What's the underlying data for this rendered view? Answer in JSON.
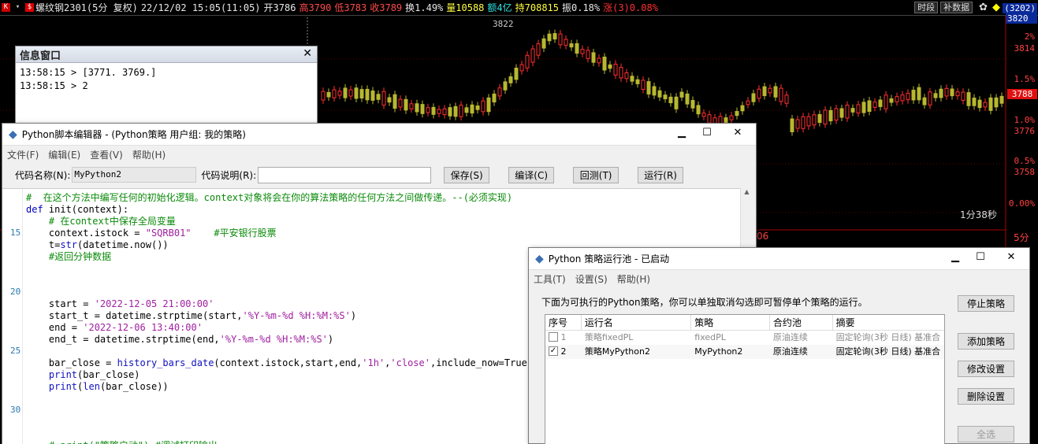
{
  "chart_header": {
    "symbol": "螺纹钢2301(5分 复权)",
    "datetime": "22/12/02 15:05(11:05)",
    "open": "开3786",
    "high": "高3790",
    "low": "低3783",
    "close": "收3789",
    "turnover": "换1.49%",
    "volume": "量10588",
    "amount": "额4亿",
    "hold": "持708815",
    "amplitude": "振0.18%",
    "change": "涨(3)0.08%",
    "btn_time": "时段",
    "btn_fill": "补数据",
    "axis_top_badge": "(3202)",
    "axis_top_value": "3820"
  },
  "chart_axis": {
    "labels": [
      "2%",
      "3814",
      "1.5%",
      "1.0%",
      "3776",
      "0.5%",
      "3758",
      "0.00%"
    ],
    "current_price": "3788",
    "peak_label": "3822",
    "timer": "1分38秒",
    "bottom_period": "5分",
    "bottom_frag": "06"
  },
  "info_window": {
    "title": "信息窗口",
    "lines": [
      "13:58:15 > [3771. 3769.]",
      "13:58:15 > 2"
    ]
  },
  "editor": {
    "title": "Python脚本编辑器 - (Python策略 用户组: 我的策略)",
    "menu": [
      "文件(F)",
      "编辑(E)",
      "查看(V)",
      "帮助(H)"
    ],
    "code_name_label": "代码名称(N):",
    "code_name_value": "MyPython2",
    "code_desc_label": "代码说明(R):",
    "buttons": [
      "保存(S)",
      "编译(C)",
      "回测(T)",
      "运行(R)"
    ],
    "line_numbers": [
      "15",
      "20",
      "25",
      "30"
    ],
    "code": [
      "#  在这个方法中编写任何的初始化逻辑。context对象将会在你的算法策略的任何方法之间做传递。--(必须实现)",
      "def init(context):",
      "    # 在context中保存全局变量",
      "    context.istock = \"SQRB01\"    #平安银行股票",
      "    t=str(datetime.now())",
      "    #返回分钟数据",
      "",
      "",
      "",
      "    start = '2022-12-05 21:00:00'",
      "    start_t = datetime.strptime(start,'%Y-%m-%d %H:%M:%S')",
      "    end = '2022-12-06 13:40:00'",
      "    end_t = datetime.strptime(end,'%Y-%m-%d %H:%M:%S')",
      "",
      "    bar_close = history_bars_date(context.istock,start,end,'1h','close',include_now=True)",
      "    print(bar_close)",
      "    print(len(bar_close))",
      "",
      "",
      "",
      "",
      "    # print(\"策略启动\") #调试打印输出"
    ]
  },
  "pool": {
    "title": "Python 策略运行池 - 已启动",
    "menu": [
      "工具(T)",
      "设置(S)",
      "帮助(H)"
    ],
    "description": "下面为可执行的Python策略，你可以单独取消勾选即可暂停单个策略的运行。",
    "columns": [
      "序号",
      "运行名",
      "策略",
      "合约池",
      "摘要"
    ],
    "rows": [
      {
        "checked": false,
        "index": "1",
        "name": "策略fixedPL",
        "strategy": "fixedPL",
        "pool": "原油连续",
        "summary": "固定轮询(3秒 日线) 基准合"
      },
      {
        "checked": true,
        "index": "2",
        "name": "策略MyPython2",
        "strategy": "MyPython2",
        "pool": "原油连续",
        "summary": "固定轮询(3秒 日线) 基准合"
      }
    ],
    "buttons": [
      "停止策略",
      "添加策略",
      "修改设置",
      "删除设置",
      "全选"
    ]
  }
}
